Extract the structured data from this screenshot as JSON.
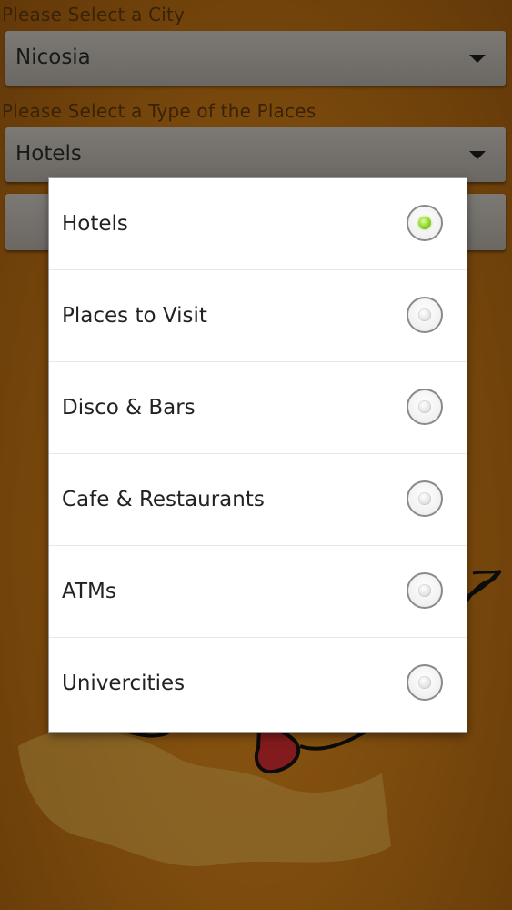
{
  "city": {
    "label": "Please Select a City",
    "selected": "Nicosia"
  },
  "place_type": {
    "label": "Please Select a Type of the Places",
    "selected": "Hotels"
  },
  "dialog": {
    "options": [
      {
        "label": "Hotels",
        "checked": true
      },
      {
        "label": "Places to Visit",
        "checked": false
      },
      {
        "label": "Disco & Bars",
        "checked": false
      },
      {
        "label": "Cafe & Restaurants",
        "checked": false
      },
      {
        "label": "ATMs",
        "checked": false
      },
      {
        "label": "Univercities",
        "checked": false
      }
    ]
  },
  "colors": {
    "background": "#a86512",
    "radio_selected": "#8fd22c",
    "dialog_bg": "#ffffff"
  }
}
